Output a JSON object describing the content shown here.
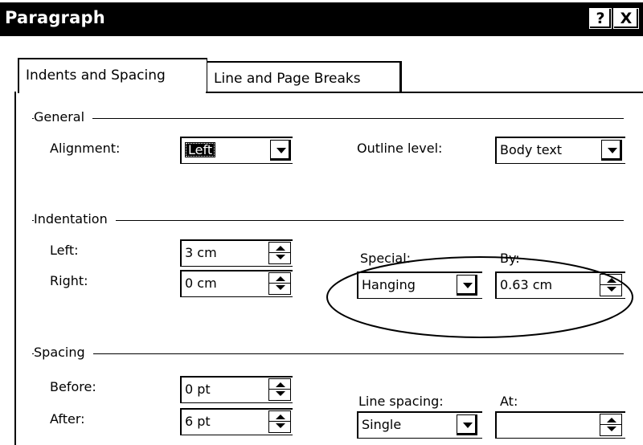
{
  "window": {
    "title": "Paragraph",
    "help_label": "?",
    "close_label": "X"
  },
  "tabs": [
    {
      "label": "Indents and Spacing",
      "active": true
    },
    {
      "label": "Line and Page Breaks",
      "active": false
    }
  ],
  "general": {
    "group_label": "General",
    "alignment_label": "Alignment:",
    "alignment_value": "Left",
    "outline_label": "Outline level:",
    "outline_value": "Body text"
  },
  "indentation": {
    "group_label": "Indentation",
    "left_label": "Left:",
    "left_value": "3 cm",
    "right_label": "Right:",
    "right_value": "0 cm",
    "special_label": "Special:",
    "special_value": "Hanging",
    "by_label": "By:",
    "by_value": "0.63 cm"
  },
  "spacing": {
    "group_label": "Spacing",
    "before_label": "Before:",
    "before_value": "0 pt",
    "after_label": "After:",
    "after_value": "6 pt",
    "line_spacing_label": "Line spacing:",
    "line_spacing_value": "Single",
    "at_label": "At:",
    "at_value": ""
  },
  "annotation": {
    "shape": "ellipse",
    "highlights": "special and by controls"
  }
}
